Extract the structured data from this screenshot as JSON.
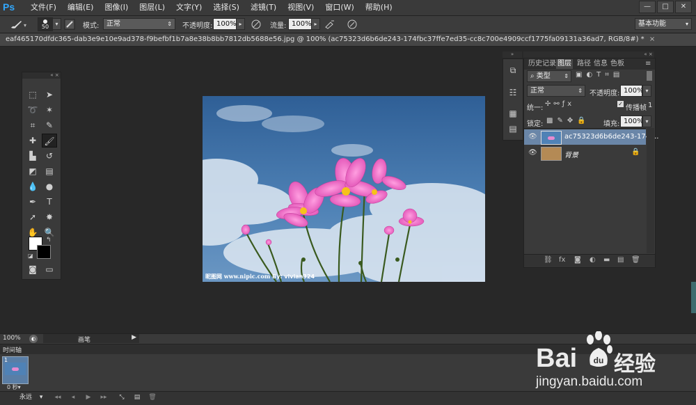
{
  "app": {
    "logo": "Ps"
  },
  "menu": [
    "文件(F)",
    "编辑(E)",
    "图像(I)",
    "图层(L)",
    "文字(Y)",
    "选择(S)",
    "滤镜(T)",
    "视图(V)",
    "窗口(W)",
    "帮助(H)"
  ],
  "window_controls": [
    "—",
    "□",
    "✕"
  ],
  "options": {
    "brush_size": "50",
    "mode_label": "模式:",
    "mode_value": "正常",
    "opacity_label": "不透明度:",
    "opacity_value": "100%",
    "flow_label": "流量:",
    "flow_value": "100%",
    "workspace": "基本功能"
  },
  "document": {
    "tab_title": "eaf465170dfdc365-dab3e9e10e9ad378-f9befbf1b7a8e38b8bb7812db5688e56.jpg @ 100% (ac75323d6b6de243-174fbc37ffe7ed35-cc8c700e4909ccf1775fa09131a36ad7, RGB/8#) *",
    "tab_close": "×",
    "canvas_watermark_left": "昵图网 www.nipic.com",
    "canvas_watermark_by": "By: vivian324"
  },
  "layers_panel": {
    "tabs": [
      "历史记录",
      "图层",
      "路径",
      "信息",
      "色板"
    ],
    "filter_kind": "类型",
    "blend_mode": "正常",
    "opacity_label": "不透明度:",
    "opacity_value": "100%",
    "unify_label": "统一:",
    "propagate_label": "传播帧",
    "propagate_value": "1",
    "lock_label": "锁定:",
    "fill_label": "填充:",
    "fill_value": "100%",
    "layers": [
      {
        "name": "ac75323d6b6de243-174f...",
        "selected": true
      },
      {
        "name": "背景",
        "selected": false,
        "locked": true
      }
    ],
    "footer_icons": [
      "link-icon",
      "fx-icon",
      "mask-icon",
      "adjustment-icon",
      "group-icon",
      "new-layer-icon",
      "trash-icon"
    ]
  },
  "status": {
    "zoom": "100%",
    "brush_tab": "画笔"
  },
  "timeline": {
    "title": "时间轴",
    "frame_number": "1",
    "frame_delay": "0 秒",
    "loop": "永远"
  },
  "watermark": {
    "brand": "Bai",
    "brand2": "经验",
    "url": "jingyan.baidu.com"
  }
}
